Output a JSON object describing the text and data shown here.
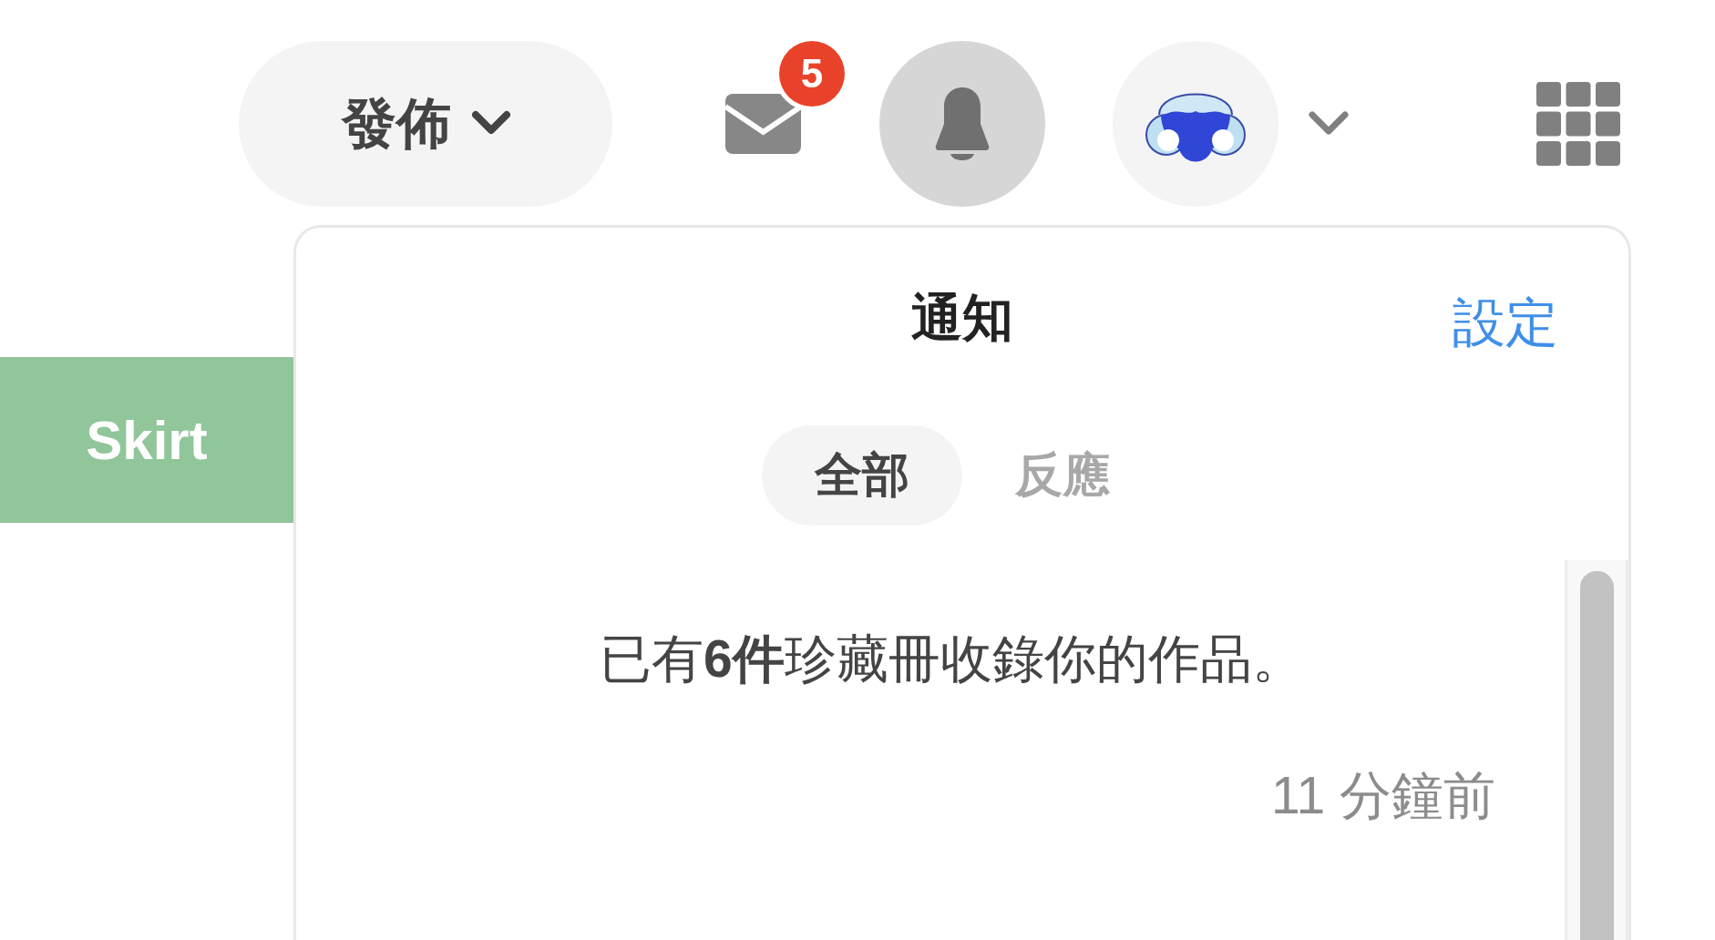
{
  "header": {
    "post_button": {
      "label": "發佈"
    },
    "messages": {
      "badge": "5"
    },
    "notifications_button": {
      "selected": true
    }
  },
  "category_tab": {
    "label": "Skirt"
  },
  "notifications_panel": {
    "title": "通知",
    "settings_link": "設定",
    "tabs": [
      {
        "label": "全部",
        "selected": true
      },
      {
        "label": "反應",
        "selected": false
      }
    ],
    "items": [
      {
        "text": "已有**6件**珍藏冊收錄你的作品。",
        "time": "11 分鐘前"
      }
    ]
  }
}
